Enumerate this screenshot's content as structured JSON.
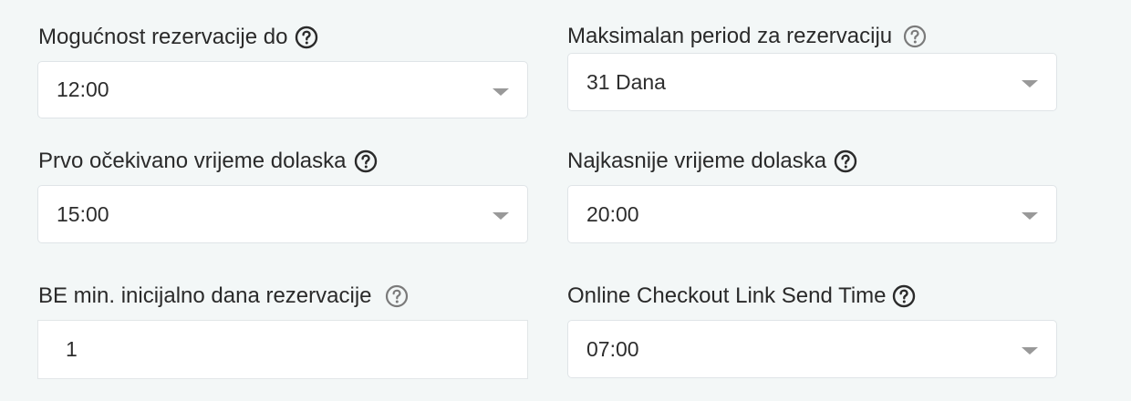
{
  "left_column": [
    {
      "label": "Mogućnost rezervacije do",
      "value": "12:00",
      "kind": "select",
      "help_icon": "question-circle-icon"
    },
    {
      "label": "Prvo očekivano vrijeme dolaska",
      "value": "15:00",
      "kind": "select",
      "help_icon": "question-circle-icon"
    },
    {
      "label": "BE min. inicijalno dana rezervacije",
      "value": "1",
      "kind": "input",
      "help_icon": "question-circle-icon"
    }
  ],
  "right_column": [
    {
      "label": "Maksimalan period za rezervaciju",
      "value": "31 Dana",
      "kind": "select",
      "help_icon": "question-circle-icon"
    },
    {
      "label": "Najkasnije vrijeme dolaska",
      "value": "20:00",
      "kind": "select",
      "help_icon": "question-circle-icon"
    },
    {
      "label": "Online Checkout Link Send Time",
      "value": "07:00",
      "kind": "select",
      "help_icon": "question-circle-icon"
    }
  ],
  "colors": {
    "background": "#f3f7f7",
    "field_background": "#ffffff",
    "border": "#dfe4e7",
    "help_icon_dark": "#2a2a2a",
    "help_icon_muted": "#7a7a7a",
    "caret": "#999999"
  }
}
